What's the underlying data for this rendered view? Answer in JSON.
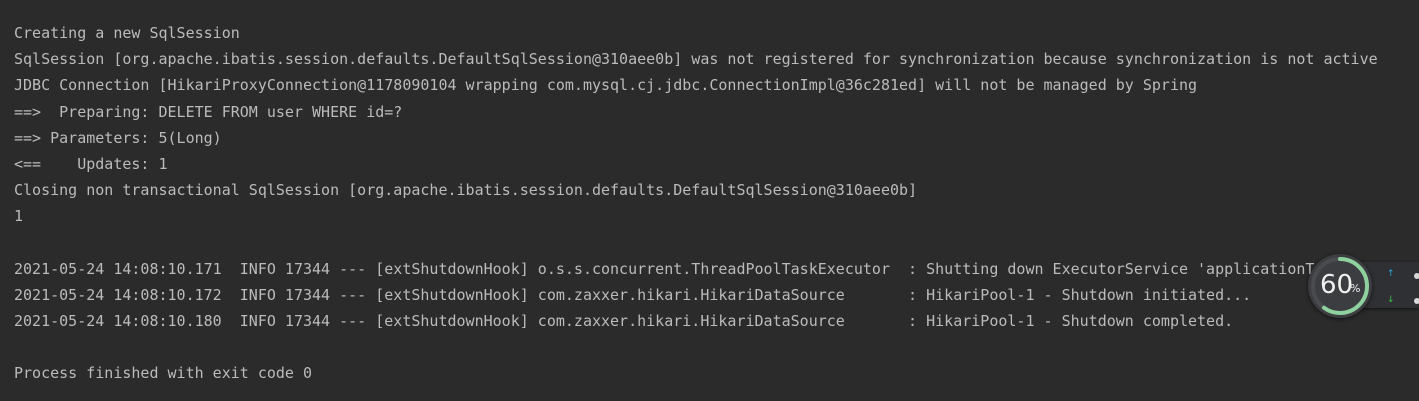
{
  "console": {
    "lines": [
      "Creating a new SqlSession",
      "SqlSession [org.apache.ibatis.session.defaults.DefaultSqlSession@310aee0b] was not registered for synchronization because synchronization is not active",
      "JDBC Connection [HikariProxyConnection@1178090104 wrapping com.mysql.cj.jdbc.ConnectionImpl@36c281ed] will not be managed by Spring",
      "==>  Preparing: DELETE FROM user WHERE id=?",
      "==> Parameters: 5(Long)",
      "<==    Updates: 1",
      "Closing non transactional SqlSession [org.apache.ibatis.session.defaults.DefaultSqlSession@310aee0b]",
      "1",
      "",
      "2021-05-24 14:08:10.171  INFO 17344 --- [extShutdownHook] o.s.s.concurrent.ThreadPoolTaskExecutor  : Shutting down ExecutorService 'applicationTaskExecutor'",
      "2021-05-24 14:08:10.172  INFO 17344 --- [extShutdownHook] com.zaxxer.hikari.HikariDataSource       : HikariPool-1 - Shutdown initiated...",
      "2021-05-24 14:08:10.180  INFO 17344 --- [extShutdownHook] com.zaxxer.hikari.HikariDataSource       : HikariPool-1 - Shutdown completed.",
      "",
      "Process finished with exit code 0"
    ],
    "text_color": "#bbbbbb",
    "background_color": "#2b2b2b"
  },
  "speed_widget": {
    "percent_value": "60",
    "percent_sign": "%",
    "progress_fraction": 0.6,
    "up_icon": "arrow-up-icon",
    "down_icon": "arrow-down-icon",
    "up_arrow_glyph": "↑",
    "down_arrow_glyph": "↓",
    "ring_color": "#8fd19e",
    "up_color": "#2fa8e0",
    "down_color": "#38c04a"
  }
}
